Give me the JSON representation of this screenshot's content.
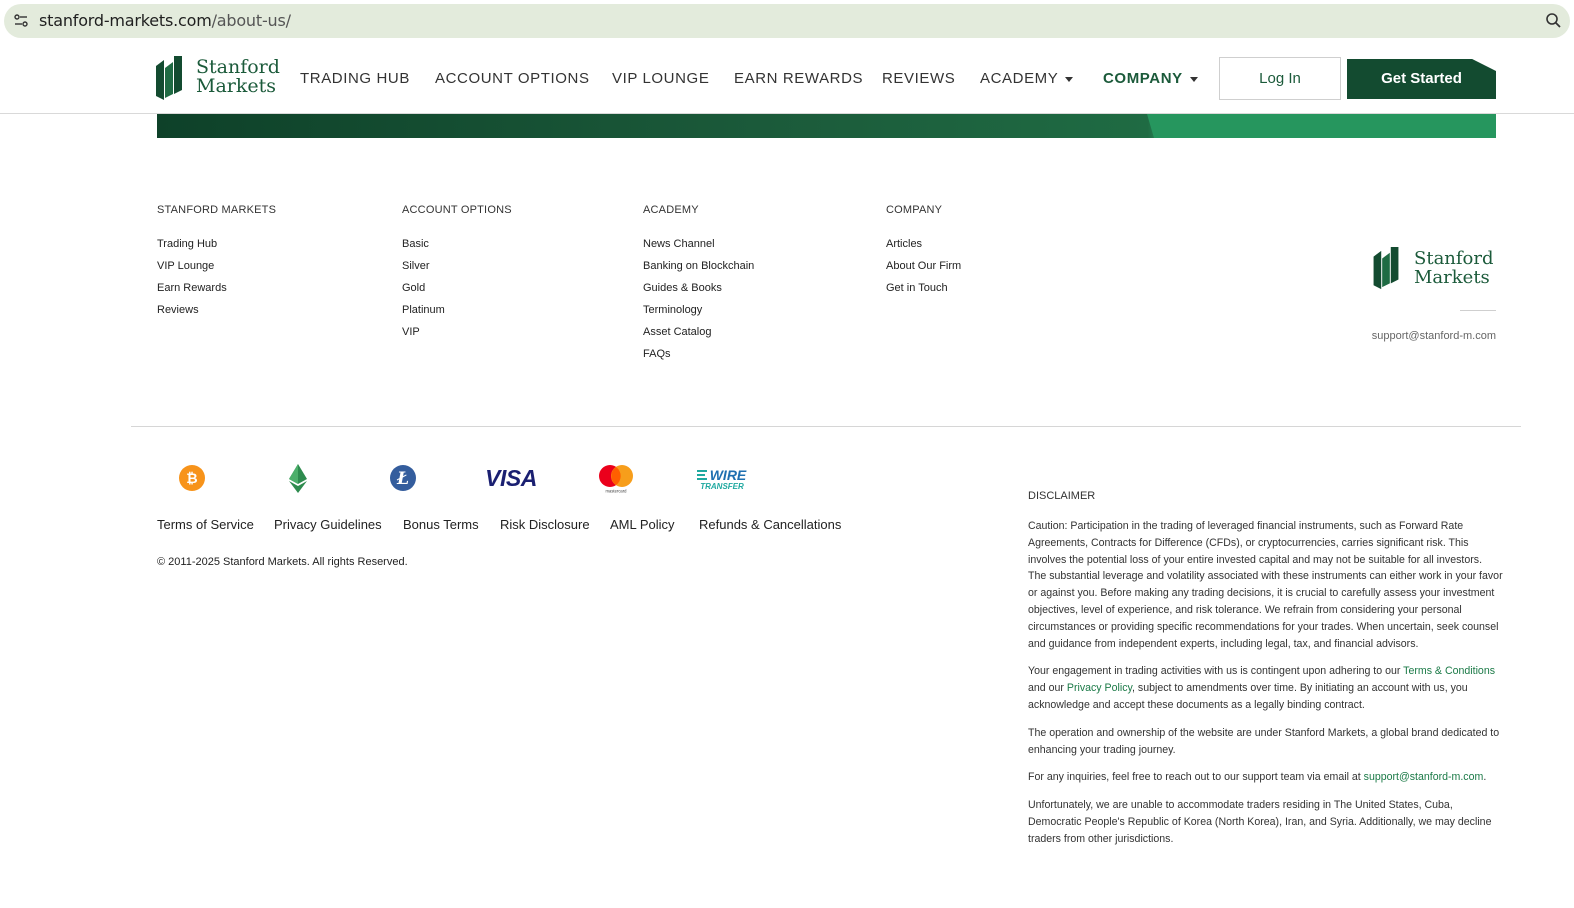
{
  "browser": {
    "url_domain": "stanford-markets.com",
    "url_path": "/about-us/"
  },
  "brand": {
    "name_line1": "Stanford",
    "name_line2": "Markets",
    "color_primary": "#134b30",
    "color_accent": "#2e9a63"
  },
  "nav": {
    "items": [
      {
        "label": "TRADING HUB"
      },
      {
        "label": "ACCOUNT OPTIONS"
      },
      {
        "label": "VIP LOUNGE"
      },
      {
        "label": "EARN REWARDS"
      },
      {
        "label": "REVIEWS"
      },
      {
        "label": "ACADEMY"
      },
      {
        "label": "COMPANY"
      }
    ],
    "login_label": "Log In",
    "cta_label": "Get Started"
  },
  "footer": {
    "columns": [
      {
        "title": "STANFORD MARKETS",
        "links": [
          "Trading Hub",
          "VIP Lounge",
          "Earn Rewards",
          "Reviews"
        ]
      },
      {
        "title": "ACCOUNT OPTIONS",
        "links": [
          "Basic",
          "Silver",
          "Gold",
          "Platinum",
          "VIP"
        ]
      },
      {
        "title": "ACADEMY",
        "links": [
          "News Channel",
          "Banking on Blockchain",
          "Guides & Books",
          "Terminology",
          "Asset Catalog",
          "FAQs"
        ]
      },
      {
        "title": "COMPANY",
        "links": [
          "Articles",
          "About Our Firm",
          "Get in Touch"
        ]
      }
    ],
    "email": "support@stanford-m.com",
    "payments": [
      "bitcoin-icon",
      "ethereum-icon",
      "litecoin-icon",
      "visa-icon",
      "mastercard-icon",
      "wire-transfer-icon"
    ],
    "payment_labels": {
      "visa": "VISA",
      "mastercard": "mastercard",
      "wire_top": "WIRE",
      "wire_bottom": "TRANSFER"
    },
    "legal_links": [
      "Terms of Service",
      "Privacy Guidelines",
      "Bonus Terms",
      "Risk Disclosure",
      "AML Policy",
      "Refunds & Cancellations"
    ],
    "copyright": "© 2011-2025 Stanford Markets. All rights Reserved."
  },
  "disclaimer": {
    "title": "DISCLAIMER",
    "p1": "Caution: Participation in the trading of leveraged financial instruments, such as Forward Rate Agreements, Contracts for Difference (CFDs), or cryptocurrencies, carries significant risk. This involves the potential loss of your entire invested capital and may not be suitable for all investors. The substantial leverage and volatility associated with these instruments can either work in your favor or against you. Before making any trading decisions, it is crucial to carefully assess your investment objectives, level of experience, and risk tolerance. We refrain from considering your personal circumstances or providing specific recommendations for your trades. When uncertain, seek counsel and guidance from independent experts, including legal, tax, and financial advisors.",
    "p2_a": "Your engagement in trading activities with us is contingent upon adhering to our ",
    "p2_link1": "Terms & Conditions",
    "p2_b": " and our ",
    "p2_link2": "Privacy Policy",
    "p2_c": ", subject to amendments over time. By initiating an account with us, you acknowledge and accept these documents as a legally binding contract.",
    "p3": "The operation and ownership of the website are under Stanford Markets, a global brand dedicated to enhancing your trading journey.",
    "p4_a": "For any inquiries, feel free to reach out to our support team via email at ",
    "p4_link": "support@stanford-m.com",
    "p4_b": ".",
    "p5": "Unfortunately, we are unable to accommodate traders residing in The United States, Cuba, Democratic People's Republic of Korea (North Korea), Iran, and Syria. Additionally, we may decline traders from other jurisdictions."
  }
}
